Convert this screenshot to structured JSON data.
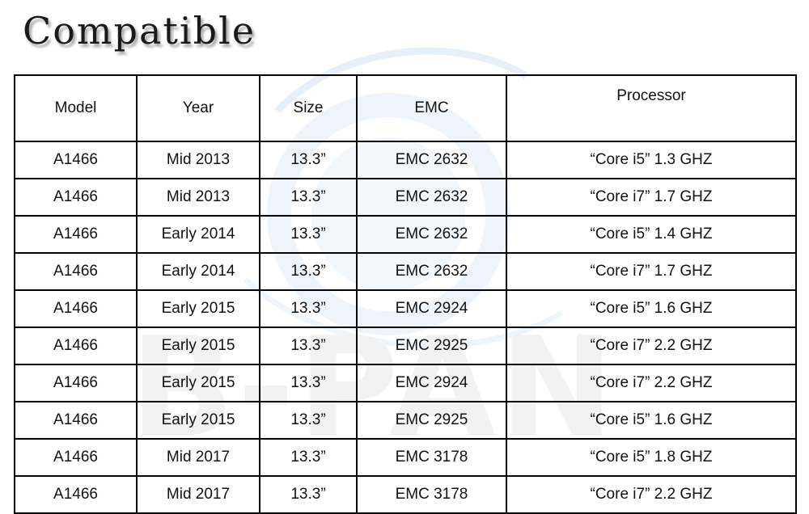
{
  "page": {
    "title": "Compatible",
    "background_color": "#ffffff",
    "text_color": "#111111",
    "border_color": "#000000"
  },
  "watermark": {
    "big_text": "B-PAN",
    "big_text_color": "#f2f2f2",
    "ring_color": "#eaf2fb"
  },
  "table": {
    "columns": [
      {
        "key": "model",
        "label": "Model"
      },
      {
        "key": "year",
        "label": "Year"
      },
      {
        "key": "size",
        "label": "Size"
      },
      {
        "key": "emc",
        "label": "EMC"
      },
      {
        "key": "processor",
        "label": "Processor"
      }
    ],
    "rows": [
      {
        "model": "A1466",
        "year": "Mid 2013",
        "size": "13.3”",
        "emc": "EMC 2632",
        "processor": "“Core i5” 1.3 GHZ"
      },
      {
        "model": "A1466",
        "year": "Mid 2013",
        "size": "13.3”",
        "emc": "EMC 2632",
        "processor": "“Core i7” 1.7 GHZ"
      },
      {
        "model": "A1466",
        "year": "Early 2014",
        "size": "13.3”",
        "emc": "EMC 2632",
        "processor": "“Core i5” 1.4 GHZ"
      },
      {
        "model": "A1466",
        "year": "Early 2014",
        "size": "13.3”",
        "emc": "EMC 2632",
        "processor": "“Core i7” 1.7 GHZ"
      },
      {
        "model": "A1466",
        "year": "Early 2015",
        "size": "13.3”",
        "emc": "EMC 2924",
        "processor": "“Core i5” 1.6 GHZ"
      },
      {
        "model": "A1466",
        "year": "Early 2015",
        "size": "13.3”",
        "emc": "EMC 2925",
        "processor": "“Core i7” 2.2 GHZ"
      },
      {
        "model": "A1466",
        "year": "Early 2015",
        "size": "13.3”",
        "emc": "EMC 2924",
        "processor": "“Core i7” 2.2 GHZ"
      },
      {
        "model": "A1466",
        "year": "Early 2015",
        "size": "13.3”",
        "emc": "EMC 2925",
        "processor": "“Core i5” 1.6 GHZ"
      },
      {
        "model": "A1466",
        "year": "Mid 2017",
        "size": "13.3”",
        "emc": "EMC 3178",
        "processor": "“Core i5” 1.8 GHZ"
      },
      {
        "model": "A1466",
        "year": "Mid 2017",
        "size": "13.3”",
        "emc": "EMC 3178",
        "processor": "“Core i7” 2.2 GHZ"
      }
    ]
  }
}
